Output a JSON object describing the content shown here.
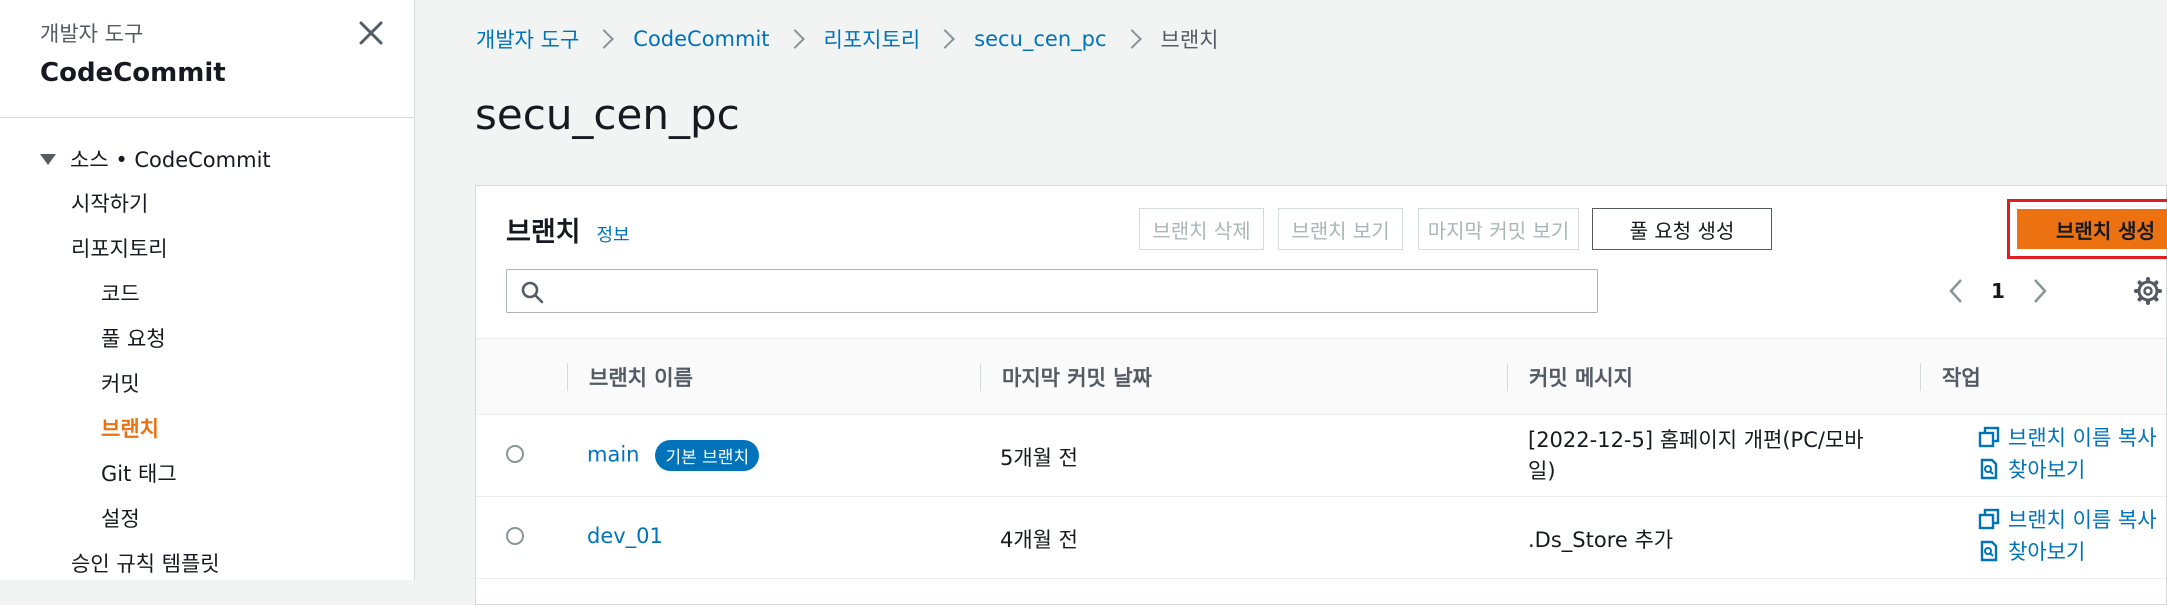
{
  "sidebar": {
    "subtitle": "개발자 도구",
    "title": "CodeCommit",
    "section": "소스 • CodeCommit",
    "items": [
      {
        "label": "시작하기"
      },
      {
        "label": "리포지토리"
      },
      {
        "label": "코드"
      },
      {
        "label": "풀 요청"
      },
      {
        "label": "커밋"
      },
      {
        "label": "브랜치"
      },
      {
        "label": "Git 태그"
      },
      {
        "label": "설정"
      },
      {
        "label": "승인 규칙 템플릿"
      }
    ]
  },
  "breadcrumb": [
    "개발자 도구",
    "CodeCommit",
    "리포지토리",
    "secu_cen_pc",
    "브랜치"
  ],
  "page_title": "secu_cen_pc",
  "panel": {
    "title": "브랜치",
    "info": "정보",
    "buttons": {
      "delete": "브랜치 삭제",
      "view": "브랜치 보기",
      "last_commit": "마지막 커밋 보기",
      "pull_request": "풀 요청 생성",
      "create": "브랜치 생성"
    },
    "search_placeholder": "",
    "page": "1"
  },
  "table": {
    "headers": [
      "브랜치 이름",
      "마지막 커밋 날짜",
      "커밋 메시지",
      "작업"
    ],
    "rows": [
      {
        "name": "main",
        "badge": "기본 브랜치",
        "date": "5개월 전",
        "message_line1": "[2022-12-5] 홈페이지 개편(PC/모바",
        "message_line2": "일)",
        "copy": "브랜치 이름 복사",
        "browse": "찾아보기"
      },
      {
        "name": "dev_01",
        "badge": "",
        "date": "4개월 전",
        "message_line1": ".Ds_Store 추가",
        "message_line2": "",
        "copy": "브랜치 이름 복사",
        "browse": "찾아보기"
      }
    ]
  },
  "colors": {
    "accent": "#ec7211",
    "link": "#0073bb",
    "highlight": "#e31b23"
  }
}
